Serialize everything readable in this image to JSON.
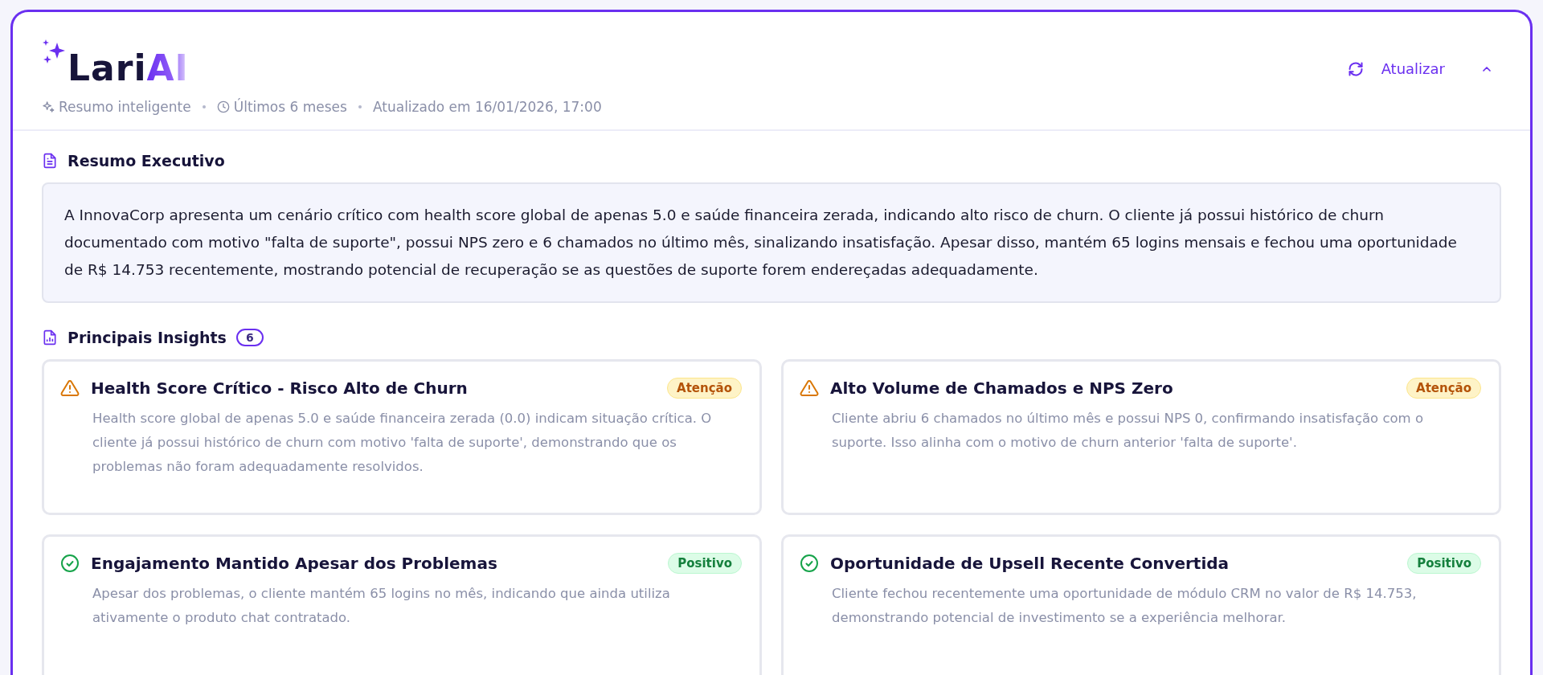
{
  "header": {
    "logo": {
      "text": "Lari",
      "accent": "AI"
    },
    "meta": [
      {
        "kind": "sparkle",
        "text": "Resumo inteligente"
      },
      {
        "kind": "clock",
        "text": "Últimos 6 meses"
      },
      {
        "kind": "plain",
        "text": "Atualizado em 16/01/2026, 17:00"
      }
    ],
    "refresh_button": "Atualizar",
    "expanded": true
  },
  "summary": {
    "title": "Resumo Executivo",
    "text": "A InnovaCorp apresenta um cenário crítico com health score global de apenas 5.0 e saúde financeira zerada, indicando alto risco de churn. O cliente já possui histórico de churn documentado com motivo \"falta de suporte\", possui NPS zero e 6 chamados no último mês, sinalizando insatisfação. Apesar disso, mantém 65 logins mensais e fechou uma oportunidade de R$ 14.753 recentemente, mostrando potencial de recuperação se as questões de suporte forem endereçadas adequadamente."
  },
  "insights": {
    "title": "Principais Insights",
    "count": "6",
    "cards": [
      {
        "kind": "warning",
        "title": "Health Score Crítico - Risco Alto de Churn",
        "badge": "Atenção",
        "text": "Health score global de apenas 5.0 e saúde financeira zerada (0.0) indicam situação crítica. O cliente já possui histórico de churn com motivo 'falta de suporte', demonstrando que os problemas não foram adequadamente resolvidos."
      },
      {
        "kind": "warning",
        "title": "Alto Volume de Chamados e NPS Zero",
        "badge": "Atenção",
        "text": "Cliente abriu 6 chamados no último mês e possui NPS 0, confirmando insatisfação com o suporte. Isso alinha com o motivo de churn anterior 'falta de suporte'."
      },
      {
        "kind": "positive",
        "title": "Engajamento Mantido Apesar dos Problemas",
        "badge": "Positivo",
        "text": "Apesar dos problemas, o cliente mantém 65 logins no mês, indicando que ainda utiliza ativamente o produto chat contratado."
      },
      {
        "kind": "positive",
        "title": "Oportunidade de Upsell Recente Convertida",
        "badge": "Positivo",
        "text": "Cliente fechou recentemente uma oportunidade de módulo CRM no valor de R$ 14.753, demonstrando potencial de investimento se a experiência melhorar."
      }
    ]
  }
}
